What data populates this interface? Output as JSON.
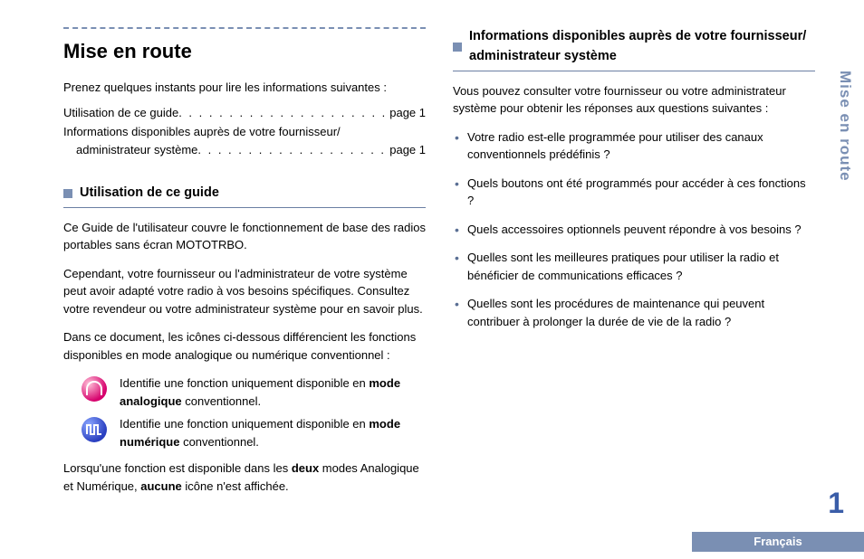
{
  "side_tab": "Mise en route",
  "page_number": "1",
  "language": "Français",
  "left": {
    "title": "Mise en route",
    "intro": "Prenez quelques instants pour lire les informations suivantes :",
    "toc": [
      {
        "label": "Utilisation de ce guide",
        "page": "page 1"
      },
      {
        "label_line1": "Informations disponibles auprès de votre fournisseur/",
        "label_line2": "administrateur système",
        "page": "page 1"
      }
    ],
    "section1": {
      "title": "Utilisation de ce guide",
      "p1": "Ce Guide de l'utilisateur couvre le fonctionnement de base des radios portables sans écran MOTOTRBO.",
      "p2": "Cependant, votre fournisseur ou l'administrateur de votre système peut avoir adapté votre radio à vos besoins spécifiques. Consultez votre revendeur ou votre administrateur système pour en savoir plus.",
      "p3": "Dans ce document, les icônes ci-dessous différencient les fonctions disponibles en mode analogique ou numérique conventionnel :",
      "analog_pre": "Identifie une fonction uniquement disponible en ",
      "analog_bold": "mode analogique",
      "analog_post": " conventionnel.",
      "digital_pre": "Identifie une fonction uniquement disponible en ",
      "digital_bold": "mode numérique",
      "digital_post": " conventionnel.",
      "p4_pre": "Lorsqu'une fonction est disponible dans les ",
      "p4_b1": "deux",
      "p4_mid": " modes Analogique et Numérique, ",
      "p4_b2": "aucune",
      "p4_post": " icône n'est affichée."
    }
  },
  "right": {
    "section2": {
      "title": "Informations disponibles auprès de votre fournisseur/ administrateur système",
      "intro": "Vous pouvez consulter votre fournisseur ou votre administrateur système pour obtenir les réponses aux questions suivantes :",
      "items": [
        "Votre radio est-elle programmée pour utiliser des canaux conventionnels prédéfinis ?",
        "Quels boutons ont été programmés pour accéder à ces fonctions ?",
        "Quels accessoires optionnels peuvent répondre à vos besoins ?",
        "Quelles sont les meilleures pratiques pour utiliser la radio et bénéficier de communications efficaces ?",
        "Quelles sont les procédures de maintenance qui peuvent contribuer à prolonger la durée de vie de la radio ?"
      ]
    }
  }
}
